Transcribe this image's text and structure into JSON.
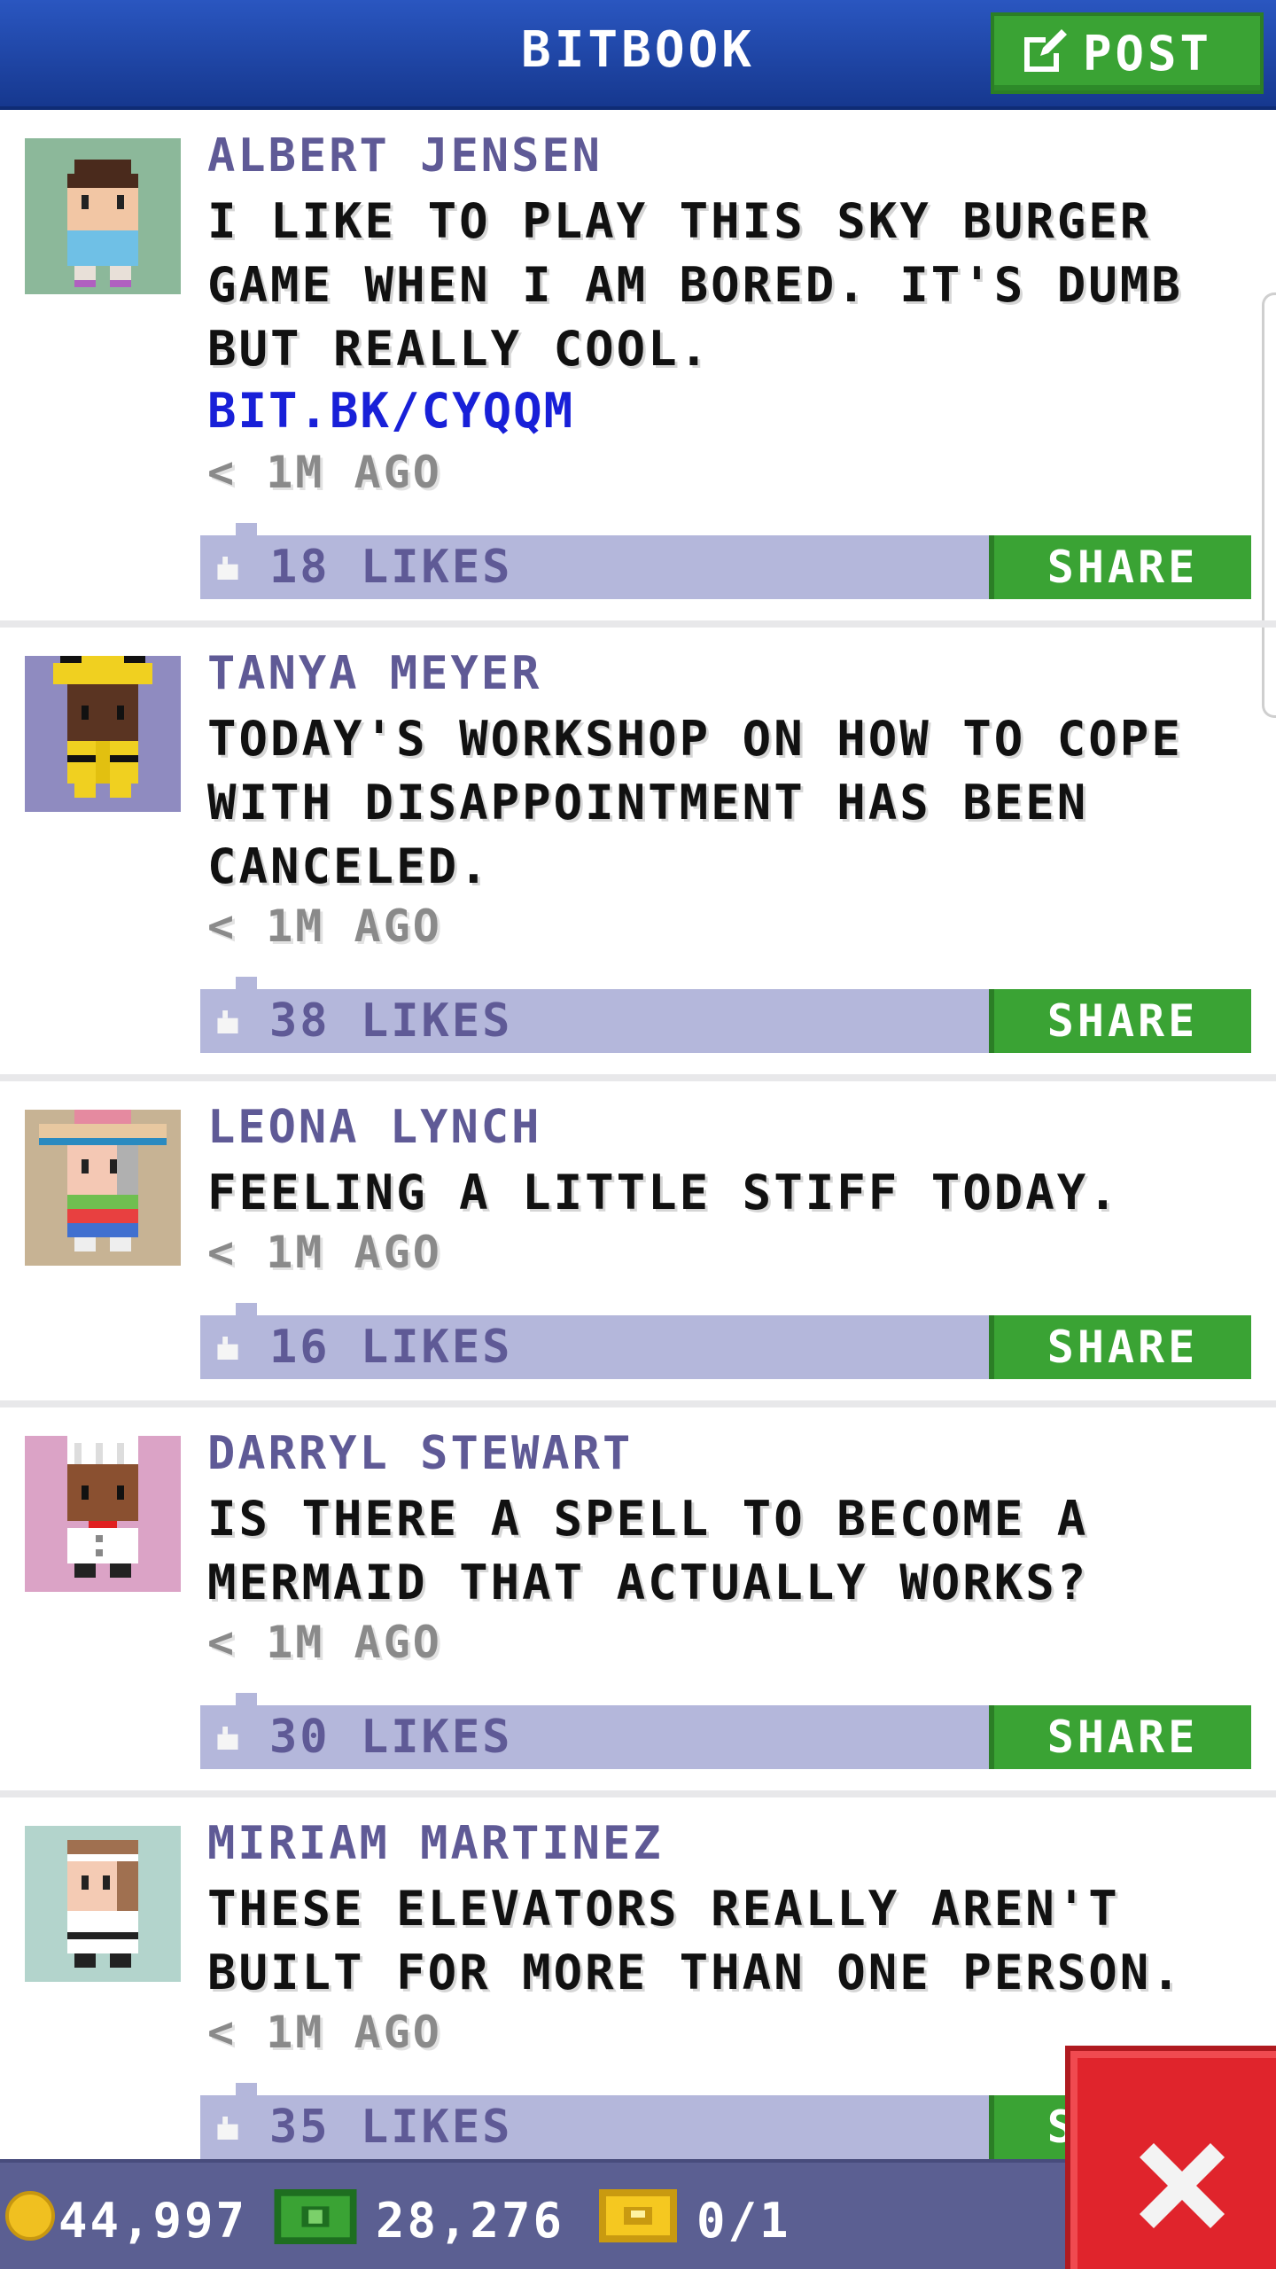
{
  "header": {
    "title": "BITBOOK",
    "post_label": "POST"
  },
  "posts": [
    {
      "author": "ALBERT JENSEN",
      "text": "I LIKE TO PLAY THIS SKY BURGER GAME WHEN I AM BORED. IT'S DUMB BUT REALLY COOL.",
      "link": "BIT.BK/CYQQM",
      "time": "< 1M AGO",
      "likes": "18 LIKES",
      "share": "SHARE",
      "avatar_bg": "#8cb89a"
    },
    {
      "author": "TANYA MEYER",
      "text": "TODAY'S WORKSHOP ON HOW TO COPE WITH DISAPPOINTMENT HAS BEEN CANCELED.",
      "time": "< 1M AGO",
      "likes": "38 LIKES",
      "share": "SHARE",
      "avatar_bg": "#8f8bc0"
    },
    {
      "author": "LEONA LYNCH",
      "text": "FEELING A LITTLE STIFF TODAY.",
      "time": "< 1M AGO",
      "likes": "16 LIKES",
      "share": "SHARE",
      "avatar_bg": "#c7b394"
    },
    {
      "author": "DARRYL STEWART",
      "text": "IS THERE A SPELL TO BECOME A MERMAID THAT ACTUALLY WORKS?",
      "time": "< 1M AGO",
      "likes": "30 LIKES",
      "share": "SHARE",
      "avatar_bg": "#dba3c6"
    },
    {
      "author": "MIRIAM MARTINEZ",
      "text": "THESE ELEVATORS REALLY AREN'T BUILT FOR MORE THAN ONE PERSON.",
      "time": "< 1M AGO",
      "likes": "35 LIKES",
      "share": "SHARE",
      "avatar_bg": "#b3d4cc"
    }
  ],
  "footer": {
    "coins": "44,997",
    "bux": "28,276",
    "tickets": "0/1"
  },
  "icons": {
    "post": "edit-icon",
    "like": "thumbs-up-icon",
    "coin": "coin-icon",
    "bux": "cash-icon",
    "tickets": "ticket-icon",
    "close": "close-icon"
  },
  "colors": {
    "header": "#1f47a8",
    "accent_green": "#3aa334",
    "like_bar": "#b4b7db",
    "author": "#5f5a96",
    "link": "#1820d8",
    "close": "#e0242c"
  }
}
